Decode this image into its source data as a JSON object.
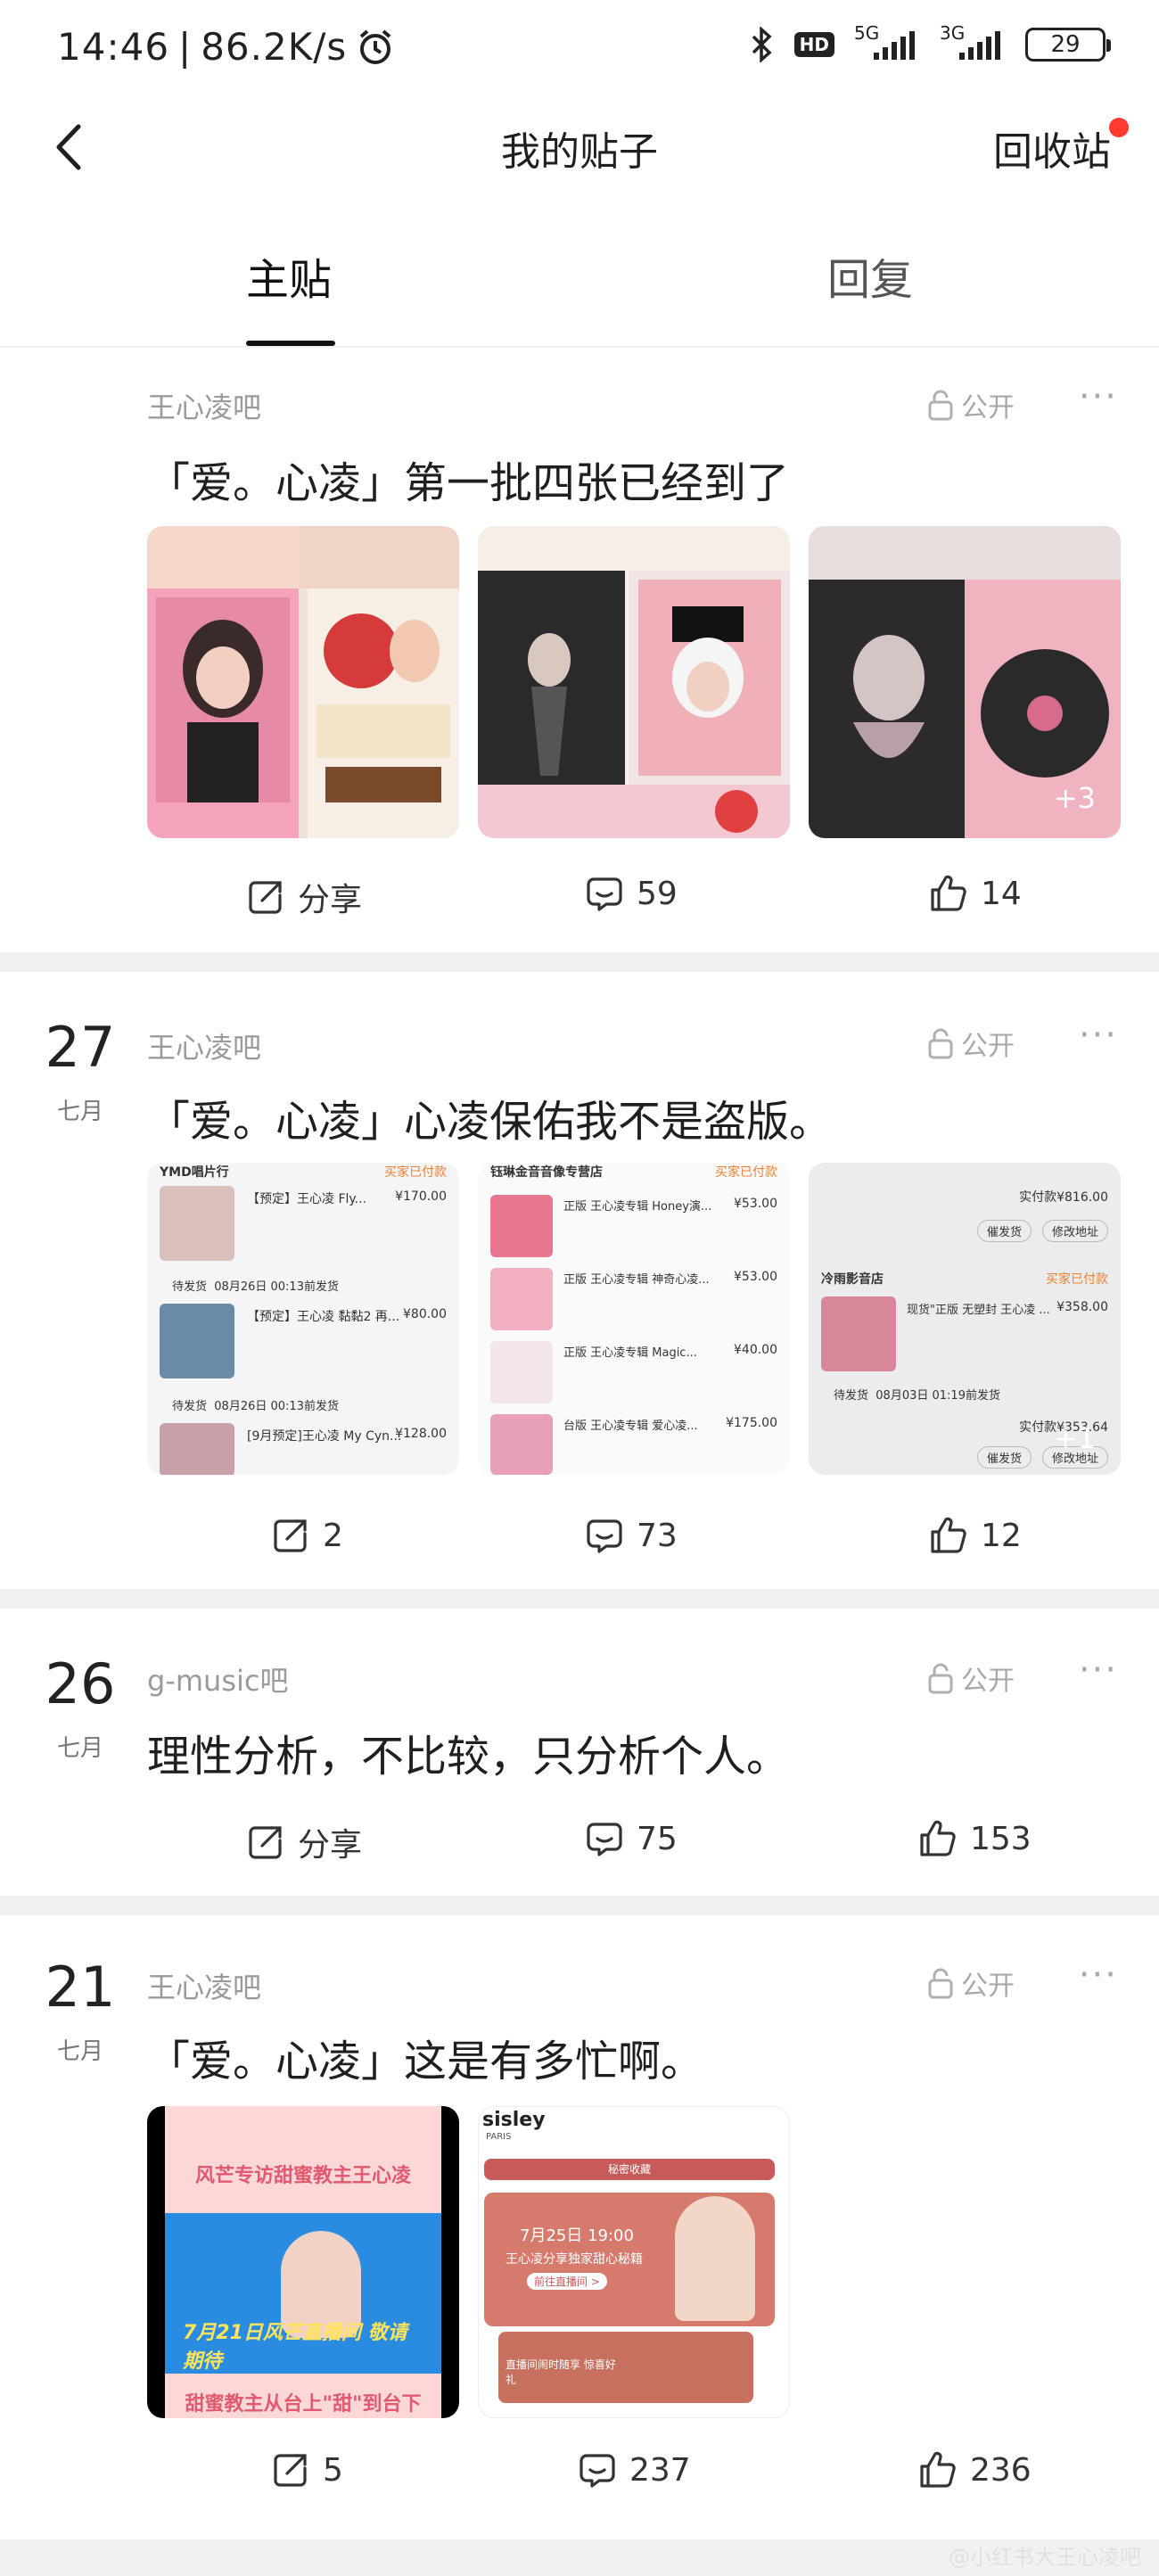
{
  "status_bar": {
    "time": "14:46",
    "net_speed": "86.2K/s",
    "sig1": "5G",
    "sig2": "3G",
    "hd": "HD",
    "battery": "29"
  },
  "nav": {
    "title": "我的贴子",
    "recycle": "回收站"
  },
  "tabs": {
    "main": "主贴",
    "reply": "回复"
  },
  "posts": [
    {
      "day": "",
      "month": "",
      "forum": "王心凌吧",
      "visibility": "公开",
      "title": "「爱。心凌」第一批四张已经到了",
      "extra_images": "+3",
      "share": "分享",
      "comments": "59",
      "likes": "14"
    },
    {
      "day": "27",
      "month": "七月",
      "forum": "王心凌吧",
      "visibility": "公开",
      "title": "「爱。心凌」心凌保佑我不是盗版。",
      "extra_images": "+1",
      "share": "2",
      "comments": "73",
      "likes": "12",
      "orders": {
        "shop1": "YMD唱片行",
        "status_paid": "买家已付款",
        "shop1_item1": "【预定】王心凌 Fly...",
        "shop1_price1": "¥170.00",
        "shop1_item2": "【预定】王心凌 黏黏2 再...",
        "shop1_price2": "¥80.00",
        "shop1_item3": "[9月预定]王心凌 My Cyn...",
        "shop1_price3": "¥128.00",
        "pending": "待发货",
        "ship_note": "08月26日 00:13前发货",
        "shop2": "钰琳金音音像专营店",
        "shop2_item1": "正版 王心凌专辑 Honey演...",
        "shop2_price1": "¥53.00",
        "shop2_item2": "正版 王心凌专辑 神奇心凌...",
        "shop2_price2": "¥53.00",
        "shop2_item3": "正版 王心凌专辑 Magic...",
        "shop2_price3": "¥40.00",
        "shop2_item4": "台版 王心凌专辑 爱心凌...",
        "shop2_price4": "¥175.00",
        "shop3": "冷雨影音店",
        "shop3_item1": "现货\"正版 无塑封 王心凌 ...",
        "shop3_price1": "¥358.00",
        "paid_total1": "实付款¥816.00",
        "paid_total2": "实付款¥353.64",
        "ship_note3": "08月03日 01:19前发货",
        "btn_remind": "催发货",
        "btn_address": "修改地址"
      }
    },
    {
      "day": "26",
      "month": "七月",
      "forum": "g-music吧",
      "visibility": "公开",
      "title": "理性分析，不比较，只分析个人。",
      "share": "分享",
      "comments": "75",
      "likes": "153"
    },
    {
      "day": "21",
      "month": "七月",
      "forum": "王心凌吧",
      "visibility": "公开",
      "title": "「爱。心凌」这是有多忙啊。",
      "share": "5",
      "comments": "237",
      "likes": "236",
      "img1": {
        "top_text": "风芒专访甜蜜教主王心凌",
        "blue_text": "7月21日风芒直播间 敬请期待",
        "bottom_text": "甜蜜教主从台上\"甜\"到台下"
      },
      "img2": {
        "brand": "sisley",
        "brand_sub": "PARIS",
        "banner": "秘密收藏",
        "date": "7月25日 19:00",
        "desc": "王心凌分享独家甜心秘籍",
        "cta": "前往直播间 >",
        "footer": "直播间闹时随享 惊喜好礼"
      }
    }
  ],
  "watermark": "@小红书大王心凌吧"
}
